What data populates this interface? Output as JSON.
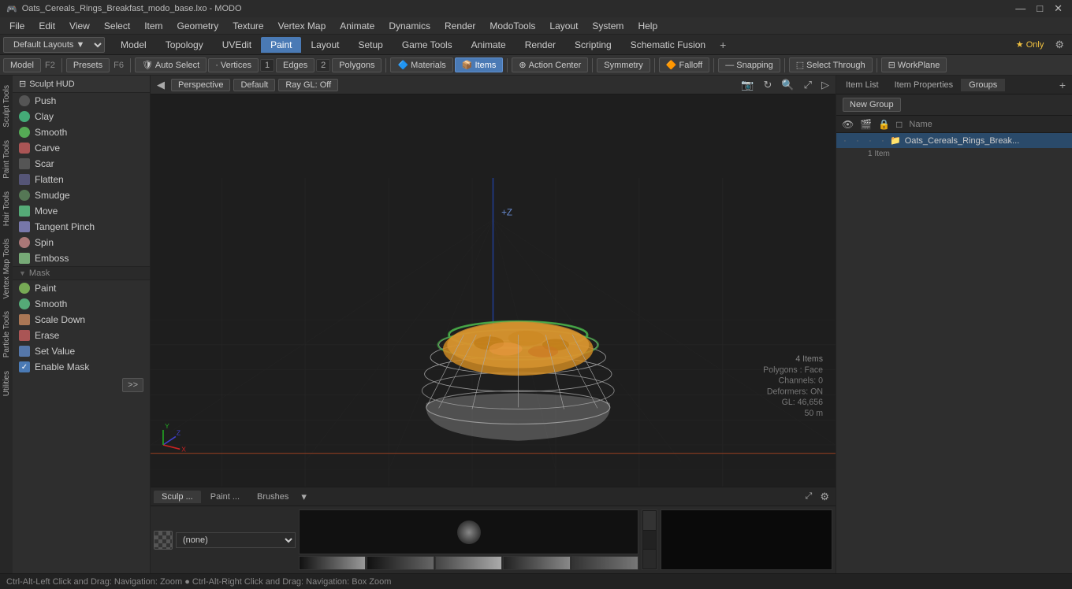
{
  "titlebar": {
    "title": "Oats_Cereals_Rings_Breakfast_modo_base.lxo - MODO",
    "controls": [
      "—",
      "□",
      "✕"
    ]
  },
  "menubar": {
    "items": [
      "File",
      "Edit",
      "View",
      "Select",
      "Item",
      "Geometry",
      "Texture",
      "Vertex Map",
      "Animate",
      "Dynamics",
      "Render",
      "ModoTools",
      "Layout",
      "System",
      "Help"
    ]
  },
  "layout_bar": {
    "dropdown_label": "Default Layouts",
    "tabs": [
      "Model",
      "Topology",
      "UVEdit",
      "Paint",
      "Layout",
      "Setup",
      "Game Tools",
      "Animate",
      "Render",
      "Scripting",
      "Schematic Fusion"
    ],
    "active_tab": "Paint",
    "star_label": "Only",
    "add_icon": "+",
    "gear_icon": "⚙"
  },
  "toolbar": {
    "model_btn": "Model",
    "f2_label": "F2",
    "presets_btn": "Presets",
    "f6_label": "F6",
    "auto_select_btn": "Auto Select",
    "vertices_btn": "Vertices",
    "vertices_num": "1",
    "edges_btn": "Edges",
    "edges_num": "2",
    "polygons_btn": "Polygons",
    "materials_btn": "Materials",
    "items_btn": "Items",
    "action_center_btn": "Action Center",
    "symmetry_btn": "Symmetry",
    "falloff_btn": "Falloff",
    "snapping_btn": "Snapping",
    "select_through_btn": "Select Through",
    "workplane_btn": "WorkPlane"
  },
  "left_sidebar": {
    "hud_label": "Sculpt HUD",
    "tools": [
      {
        "name": "Push",
        "icon": "push"
      },
      {
        "name": "Clay",
        "icon": "clay"
      },
      {
        "name": "Smooth",
        "icon": "smooth"
      },
      {
        "name": "Carve",
        "icon": "carve"
      },
      {
        "name": "Scar",
        "icon": "scar"
      },
      {
        "name": "Flatten",
        "icon": "flatten"
      },
      {
        "name": "Smudge",
        "icon": "smudge"
      },
      {
        "name": "Move",
        "icon": "move"
      },
      {
        "name": "Tangent Pinch",
        "icon": "tangent-pinch"
      },
      {
        "name": "Spin",
        "icon": "spin"
      },
      {
        "name": "Emboss",
        "icon": "emboss"
      }
    ],
    "mask_section": "Mask",
    "mask_tools": [
      {
        "name": "Paint",
        "icon": "paint"
      },
      {
        "name": "Smooth",
        "icon": "smooth"
      },
      {
        "name": "Scale Down",
        "icon": "scale-down"
      }
    ],
    "extra_tools": [
      {
        "name": "Erase",
        "icon": "erase"
      },
      {
        "name": "Set Value",
        "icon": "set-value"
      }
    ],
    "enable_mask_label": "Enable Mask",
    "expand_btn": ">>"
  },
  "vert_tabs": [
    "Sculp Tools",
    "Paint Tools",
    "Hair Tools",
    "Vertex Map Tools",
    "Particle Tools",
    "Utilities"
  ],
  "viewport": {
    "perspective_btn": "Perspective",
    "default_btn": "Default",
    "ray_gl_btn": "Ray GL: Off",
    "plus_z_label": "+Z",
    "stats": {
      "items": "4 Items",
      "polygons": "Polygons : Face",
      "channels": "Channels: 0",
      "deformers": "Deformers: ON",
      "gl": "GL: 46,656",
      "distance": "50 m"
    }
  },
  "gizmo": {
    "x_color": "#e04040",
    "y_color": "#40b040",
    "z_color": "#4040e0"
  },
  "bottom_panel": {
    "tabs": [
      "Sculp ...",
      "Paint ...",
      "Brushes"
    ],
    "active_tab": "Sculp ...",
    "brush_label": "(none)",
    "expand_icon": "⤢",
    "settings_icon": "⚙"
  },
  "right_panel": {
    "tabs": [
      "Item List",
      "Item Properties",
      "Groups"
    ],
    "active_tab": "Groups",
    "new_group_btn": "New Group",
    "col_name": "Name",
    "item_name": "Oats_Cereals_Rings_Break...",
    "item_count": "1 Item"
  },
  "status_bar": {
    "text": "Ctrl-Alt-Left Click and Drag: Navigation: Zoom ● Ctrl-Alt-Right Click and Drag: Navigation: Box Zoom"
  },
  "colors": {
    "active_tab_bg": "#4a7ab5",
    "bg_dark": "#1e1e1e",
    "bg_mid": "#2e2e2e",
    "bg_light": "#3d3d3d",
    "accent": "#4a7ab5"
  }
}
